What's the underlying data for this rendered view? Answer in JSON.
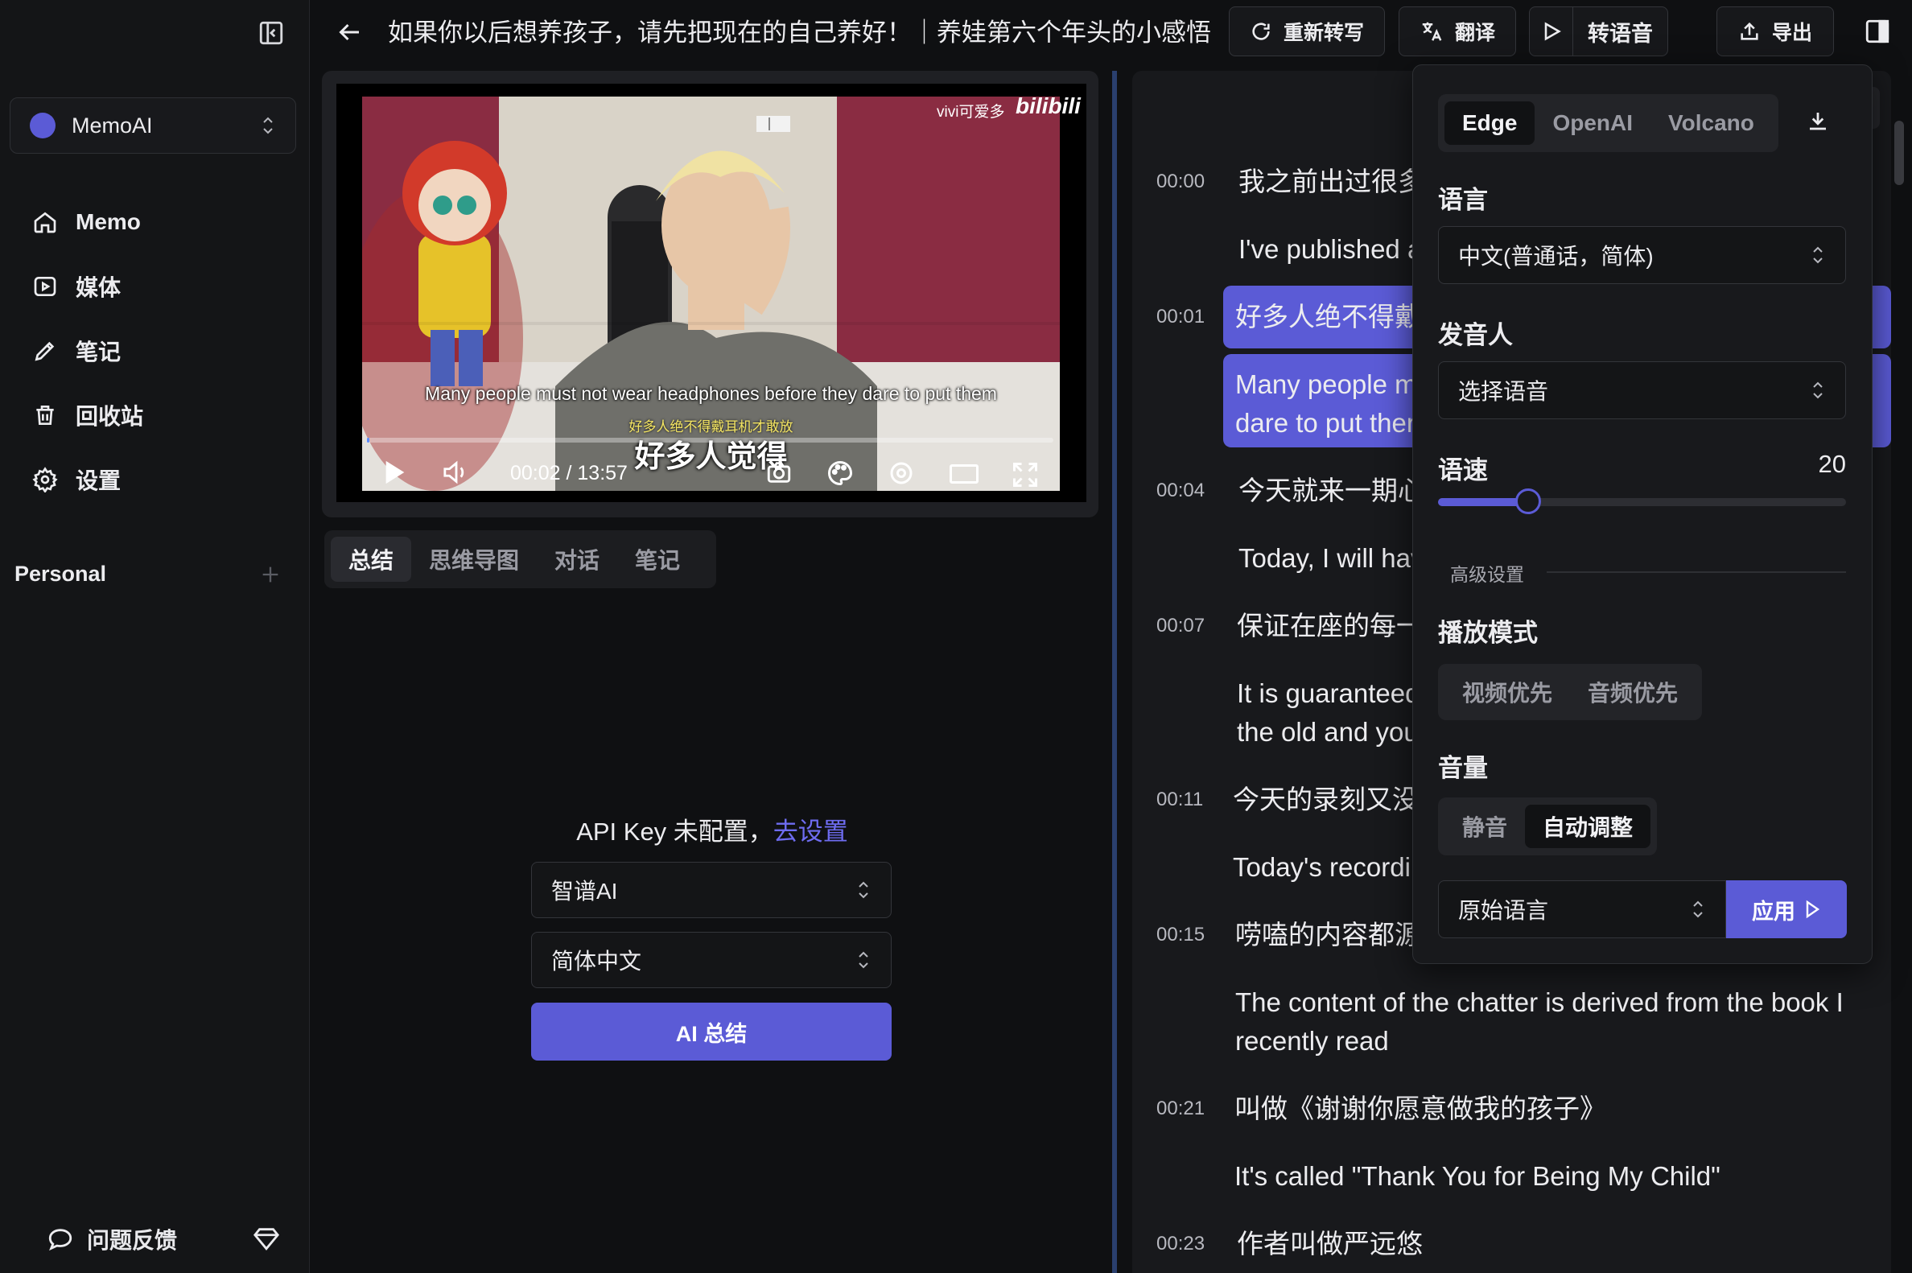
{
  "window": {
    "title": "如果你以后想养孩子，请先把现在的自己养好！｜养娃第六个年头的小感悟",
    "actions": [
      {
        "label": "重新转写",
        "icon": "refresh-icon"
      },
      {
        "label": "翻译",
        "icon": "translate-icon"
      },
      {
        "label": "转语音",
        "icon": "play-icon"
      },
      {
        "label": "导出",
        "icon": "export-icon"
      }
    ]
  },
  "sidebar": {
    "workspace": "MemoAI",
    "items": [
      {
        "label": "Memo",
        "icon": "home-icon"
      },
      {
        "label": "媒体",
        "icon": "media-icon"
      },
      {
        "label": "笔记",
        "icon": "pencil-icon"
      },
      {
        "label": "回收站",
        "icon": "trash-icon"
      },
      {
        "label": "设置",
        "icon": "gear-icon"
      }
    ],
    "section": "Personal",
    "feedback": "问题反馈"
  },
  "video": {
    "watermark": "vivi可爱多",
    "brand": "bilibili",
    "subtitle_en": "Many people must not wear headphones before they dare to put them",
    "subtitle_zh_small": "好多人绝不得戴耳机才敢放",
    "subtitle_zh": "好多人觉得",
    "time": "00:02 / 13:57",
    "progress": 0.003
  },
  "summary": {
    "tabs": [
      "总结",
      "思维导图",
      "对话",
      "笔记"
    ],
    "api_prefix": "API Key 未配置，",
    "api_link": "去设置",
    "provider": "智谱AI",
    "language": "简体中文",
    "button": "AI 总结"
  },
  "transcript": [
    {
      "time": "00:00",
      "zh": "我之前出过很多",
      "en": "I've published a"
    },
    {
      "time": "00:01",
      "zh": "好多人绝不得戴",
      "en1": "Many people m",
      "en2": "dare to put ther"
    },
    {
      "time": "00:04",
      "zh": "今天就来一期心",
      "en": "Today, I will hav"
    },
    {
      "time": "00:07",
      "zh": "保证在座的每一",
      "en1": "It is guaranteed",
      "en2": "the old and you"
    },
    {
      "time": "00:11",
      "zh": "今天的录刻又没",
      "en": "Today's recordi"
    },
    {
      "time": "00:15",
      "zh": "唠嗑的内容都源",
      "en1": "The content of the chatter is derived from the book I",
      "en2": "recently read"
    },
    {
      "time": "00:21",
      "zh": "叫做《谢谢你愿意做我的孩子》",
      "en": "It's called \"Thank You for Being My Child\""
    },
    {
      "time": "00:23",
      "zh": "作者叫做严远悠"
    }
  ],
  "tts": {
    "engines": [
      "Edge",
      "OpenAI",
      "Volcano"
    ],
    "active_engine": "Edge",
    "language_label": "语言",
    "language_value": "中文(普通话，简体)",
    "voice_label": "发音人",
    "voice_value": "选择语音",
    "speed_label": "语速",
    "speed_value": "20",
    "speed_fraction": 0.22,
    "advanced_label": "高级设置",
    "play_mode_label": "播放模式",
    "play_modes": [
      "视频优先",
      "音频优先"
    ],
    "volume_label": "音量",
    "volume_modes": [
      "静音",
      "自动调整"
    ],
    "source_value": "原始语言",
    "apply_label": "应用"
  },
  "colors": {
    "accent": "#5b5bd6",
    "bg": "#0f1012",
    "panel": "#18191c"
  }
}
